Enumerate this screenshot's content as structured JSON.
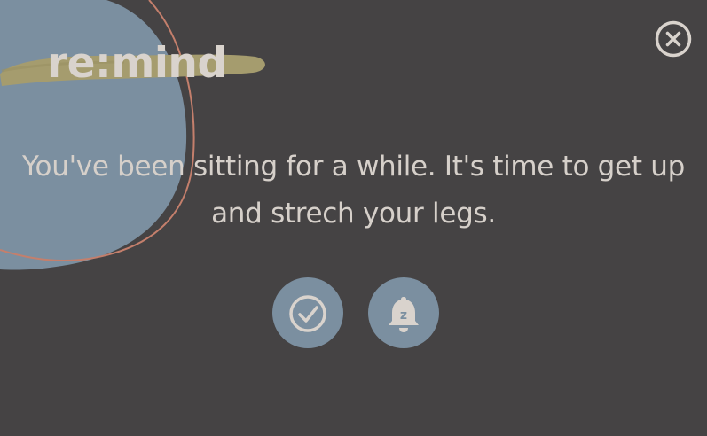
{
  "app": {
    "logo_text": "re:mind"
  },
  "reminder": {
    "message": "You've been sitting for a while. It's time to get up and strech your legs."
  },
  "actions": {
    "done_icon": "checkmark-circle-icon",
    "snooze_icon": "bell-snooze-icon",
    "snooze_glyph": "z",
    "close_icon": "close-circle-icon"
  },
  "colors": {
    "background": "#454344",
    "blob": "#7b8fa0",
    "brush_stroke": "#a59c6e",
    "outline_stroke": "#c47f6c",
    "text": "#d6d0ca",
    "button": "#7b8fa0"
  }
}
